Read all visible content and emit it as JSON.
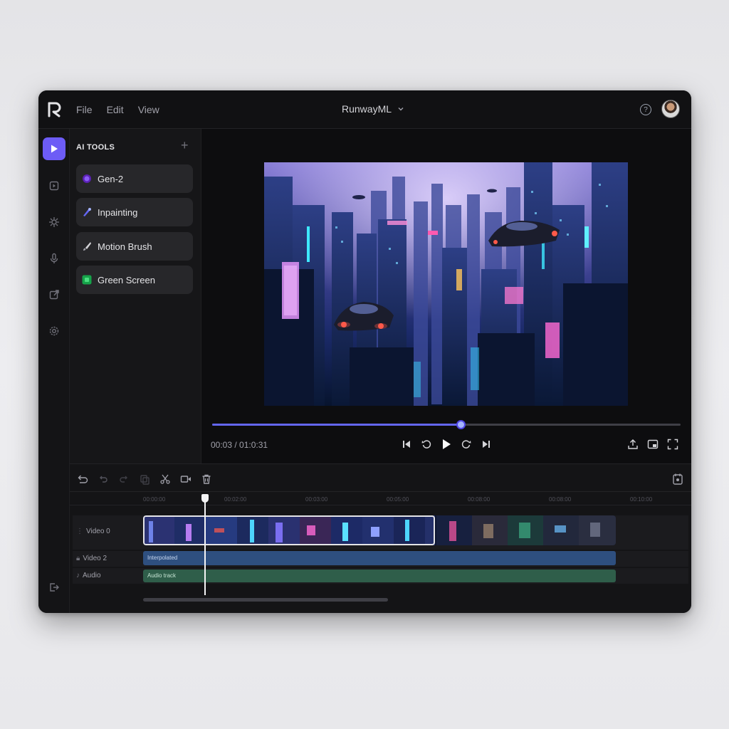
{
  "app": {
    "title": "RunwayML"
  },
  "menu": [
    "File",
    "Edit",
    "View"
  ],
  "tools_panel": {
    "header": "AI TOOLS",
    "items": [
      {
        "label": "Gen-2",
        "icon": "gen2-icon",
        "color": "#7c3aed"
      },
      {
        "label": "Inpainting",
        "icon": "inpainting-icon",
        "color": "#6366f1"
      },
      {
        "label": "Motion Brush",
        "icon": "brush-icon",
        "color": "#a1a1aa"
      },
      {
        "label": "Green Screen",
        "icon": "green-screen-icon",
        "color": "#16a34a"
      }
    ]
  },
  "player": {
    "timecode": "00:03 / 01:0:31",
    "progress_fraction": 0.53
  },
  "timeline": {
    "ruler_ticks": [
      "00:00:00",
      "00:02:00",
      "00:03:00",
      "00:05:00",
      "00:08:00",
      "00:08:00",
      "00:10:00"
    ],
    "tracks": [
      {
        "label": "Video 0"
      },
      {
        "label": "Video 2",
        "clip_label": "Interpolated"
      },
      {
        "label": "Audio",
        "clip_label": "Audio track"
      }
    ]
  },
  "colors": {
    "accent": "#6d5cf6",
    "scrub": "#6366f1",
    "video2_clip": "#2e4f7f",
    "audio_clip": "#2f5e4a"
  }
}
